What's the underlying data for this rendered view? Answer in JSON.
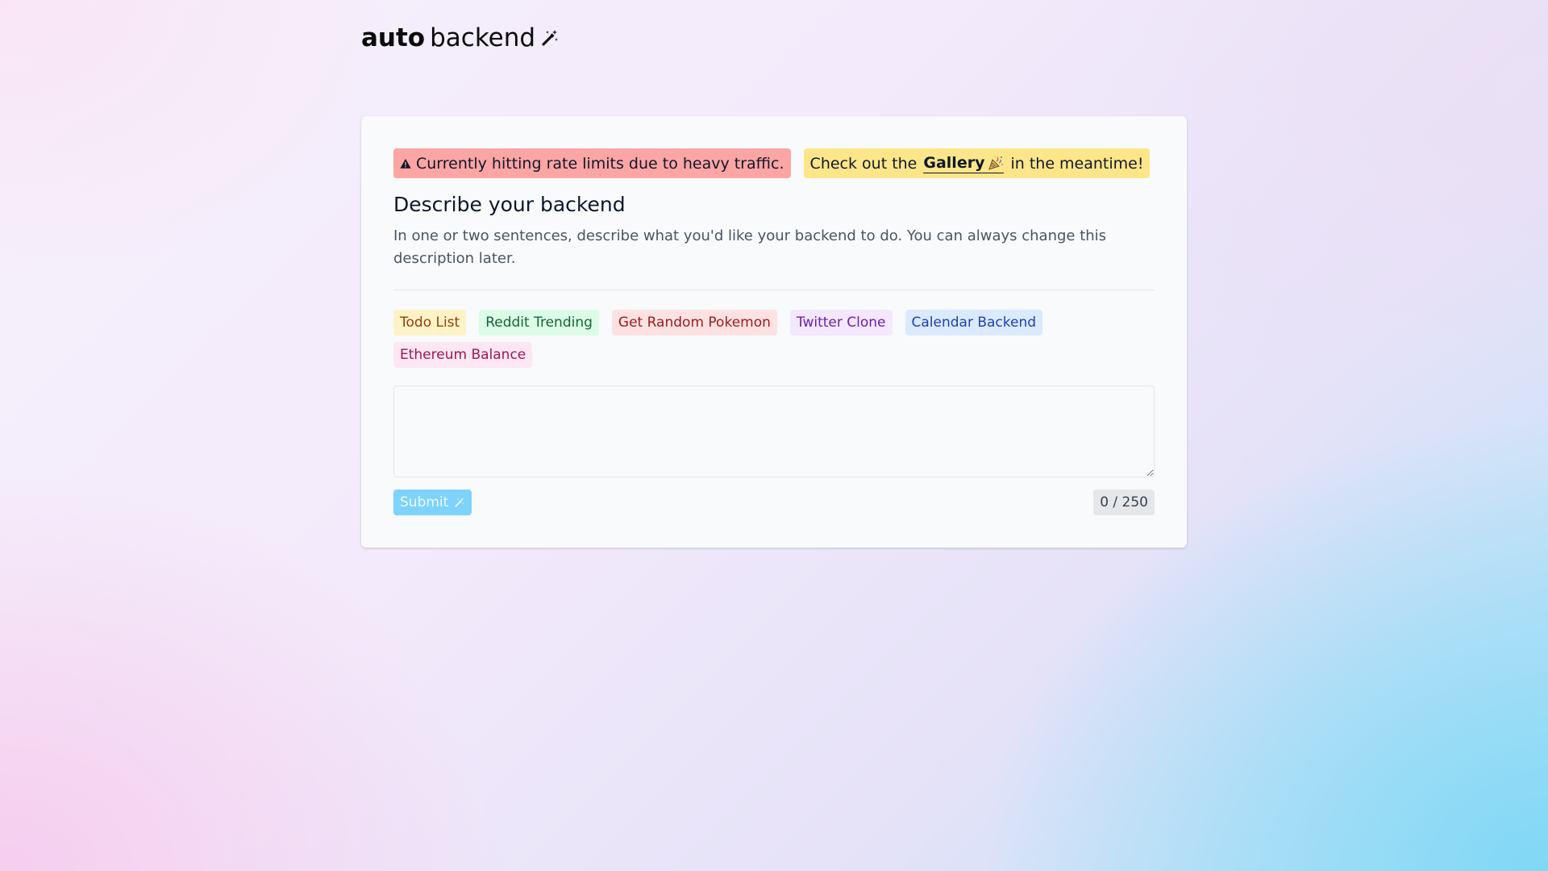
{
  "logo": {
    "bold": "auto",
    "regular": "backend",
    "icon": "magic-wand-icon"
  },
  "alerts": {
    "rate_limit": {
      "icon": "warning-icon",
      "text": "Currently hitting rate limits due to heavy traffic.",
      "color": "#fca5a5"
    },
    "gallery": {
      "prefix": "Check out the",
      "link_text": "Gallery",
      "link_icon": "party-popper-icon",
      "suffix": "in the meantime!",
      "color": "#fde68a"
    }
  },
  "form": {
    "heading": "Describe your backend",
    "description": "In one or two sentences, describe what you'd like your backend to do. You can always change this description later.",
    "presets": [
      {
        "label": "Todo List",
        "color": "#fef3c7"
      },
      {
        "label": "Reddit Trending",
        "color": "#dcfce7"
      },
      {
        "label": "Get Random Pokemon",
        "color": "#fee2e2"
      },
      {
        "label": "Twitter Clone",
        "color": "#f3e8ff"
      },
      {
        "label": "Calendar Backend",
        "color": "#dbeafe"
      },
      {
        "label": "Ethereum Balance",
        "color": "#fce7f3"
      }
    ],
    "textarea_value": "",
    "submit_label": "Submit",
    "submit_icon": "magic-wand-icon",
    "counter": "0 / 250"
  },
  "colors": {
    "accent": "#7dd3fc",
    "card_bg": "#f8fafc"
  }
}
